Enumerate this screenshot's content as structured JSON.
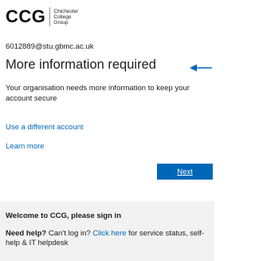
{
  "logo": {
    "mark": "CCG",
    "sub_line1": "Chichester",
    "sub_line2": "College",
    "sub_line3": "Group"
  },
  "account": {
    "email": "6012889@stu.gbmc.ac.uk"
  },
  "main": {
    "title": "More information required",
    "description": "Your organisation needs more information to keep your account secure",
    "use_different_account": "Use a different account",
    "learn_more": "Learn more",
    "next_label": "Next"
  },
  "footer": {
    "welcome": "Welcome to CCG, please sign in",
    "help_bold": "Need help?",
    "help_text_before": " Can’t log in? ",
    "help_link": "Click here",
    "help_text_after": " for service status, self-help & IT helpdesk"
  },
  "colors": {
    "accent": "#0067b8",
    "footer_bg": "#f2f2f2",
    "text": "#1b1b1b"
  },
  "annotation": {
    "arrow_icon": "arrow-left-icon",
    "arrow_color": "#0067b8"
  }
}
